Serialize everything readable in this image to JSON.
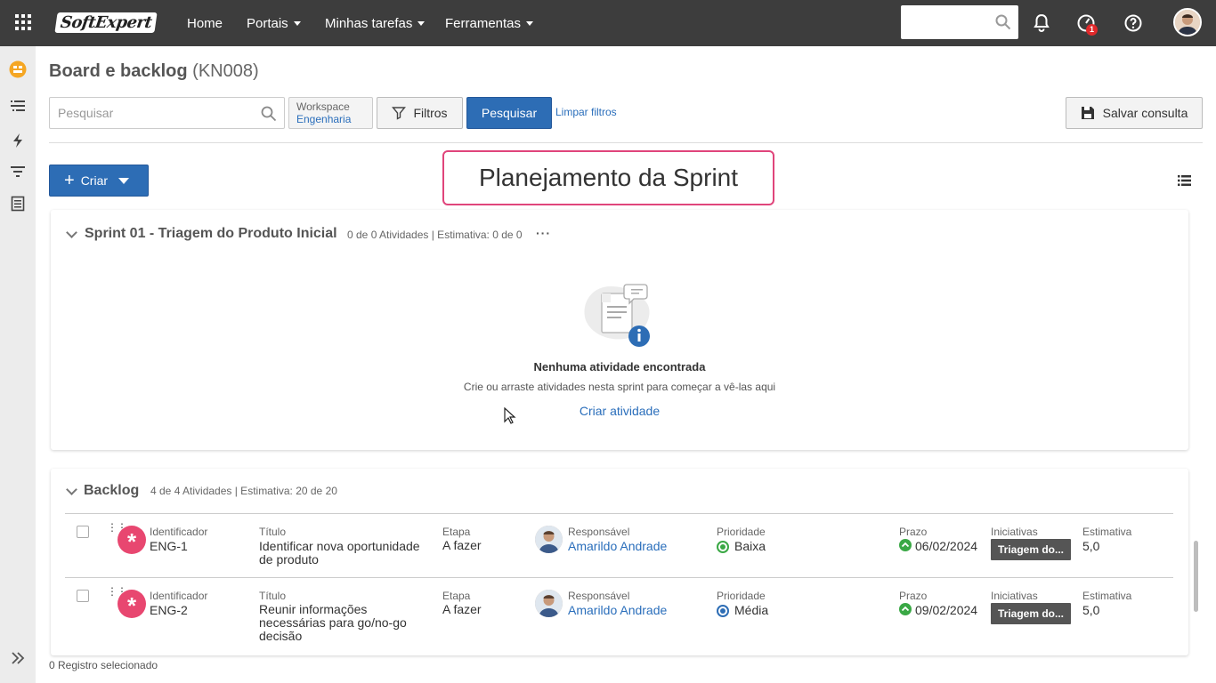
{
  "topbar": {
    "logo_text": "SoftExpert",
    "nav": [
      {
        "label": "Home",
        "dropdown": false
      },
      {
        "label": "Portais",
        "dropdown": true
      },
      {
        "label": "Minhas tarefas",
        "dropdown": true
      },
      {
        "label": "Ferramentas",
        "dropdown": true
      }
    ],
    "search_placeholder": "",
    "notifications_badge": "1"
  },
  "page": {
    "title": "Board e backlog",
    "code": "(KN008)"
  },
  "filters": {
    "search_placeholder": "Pesquisar",
    "workspace_label": "Workspace",
    "workspace_value": "Engenharia",
    "filter_button": "Filtros",
    "search_button": "Pesquisar",
    "clear_link": "Limpar filtros",
    "save_button": "Salvar consulta"
  },
  "create_button": "Criar",
  "callout_text": "Planejamento da Sprint",
  "sprint": {
    "title": "Sprint 01 - Triagem do Produto Inicial",
    "meta": "0 de 0 Atividades | Estimativa: 0 de 0",
    "more": "···",
    "empty_title": "Nenhuma atividade encontrada",
    "empty_subtitle": "Crie ou arraste atividades nesta sprint para começar a vê-las aqui",
    "empty_link": "Criar atividade"
  },
  "backlog": {
    "title": "Backlog",
    "meta": "4 de 4 Atividades | Estimativa: 20 de 20",
    "labels": {
      "id": "Identificador",
      "title": "Título",
      "stage": "Etapa",
      "owner": "Responsável",
      "priority": "Prioridade",
      "due": "Prazo",
      "initiatives": "Iniciativas",
      "estimate": "Estimativa"
    },
    "rows": [
      {
        "id": "ENG-1",
        "title": "Identificar nova oportunidade de produto",
        "stage": "A fazer",
        "owner": "Amarildo Andrade",
        "priority": "Baixa",
        "priority_color": "#3aa845",
        "due": "06/02/2024",
        "initiative": "Triagem do...",
        "estimate": "5,0"
      },
      {
        "id": "ENG-2",
        "title": "Reunir informações necessárias para go/no-go decisão",
        "stage": "A fazer",
        "owner": "Amarildo Andrade",
        "priority": "Média",
        "priority_color": "#2d6db5",
        "due": "09/02/2024",
        "initiative": "Triagem do...",
        "estimate": "5,0"
      }
    ]
  },
  "footer": {
    "status": "0 Registro selecionado"
  },
  "colors": {
    "topbar": "#3d3d3d",
    "primary": "#2d6db5",
    "accent_pink": "#e0457b",
    "type_icon": "#e84770"
  }
}
